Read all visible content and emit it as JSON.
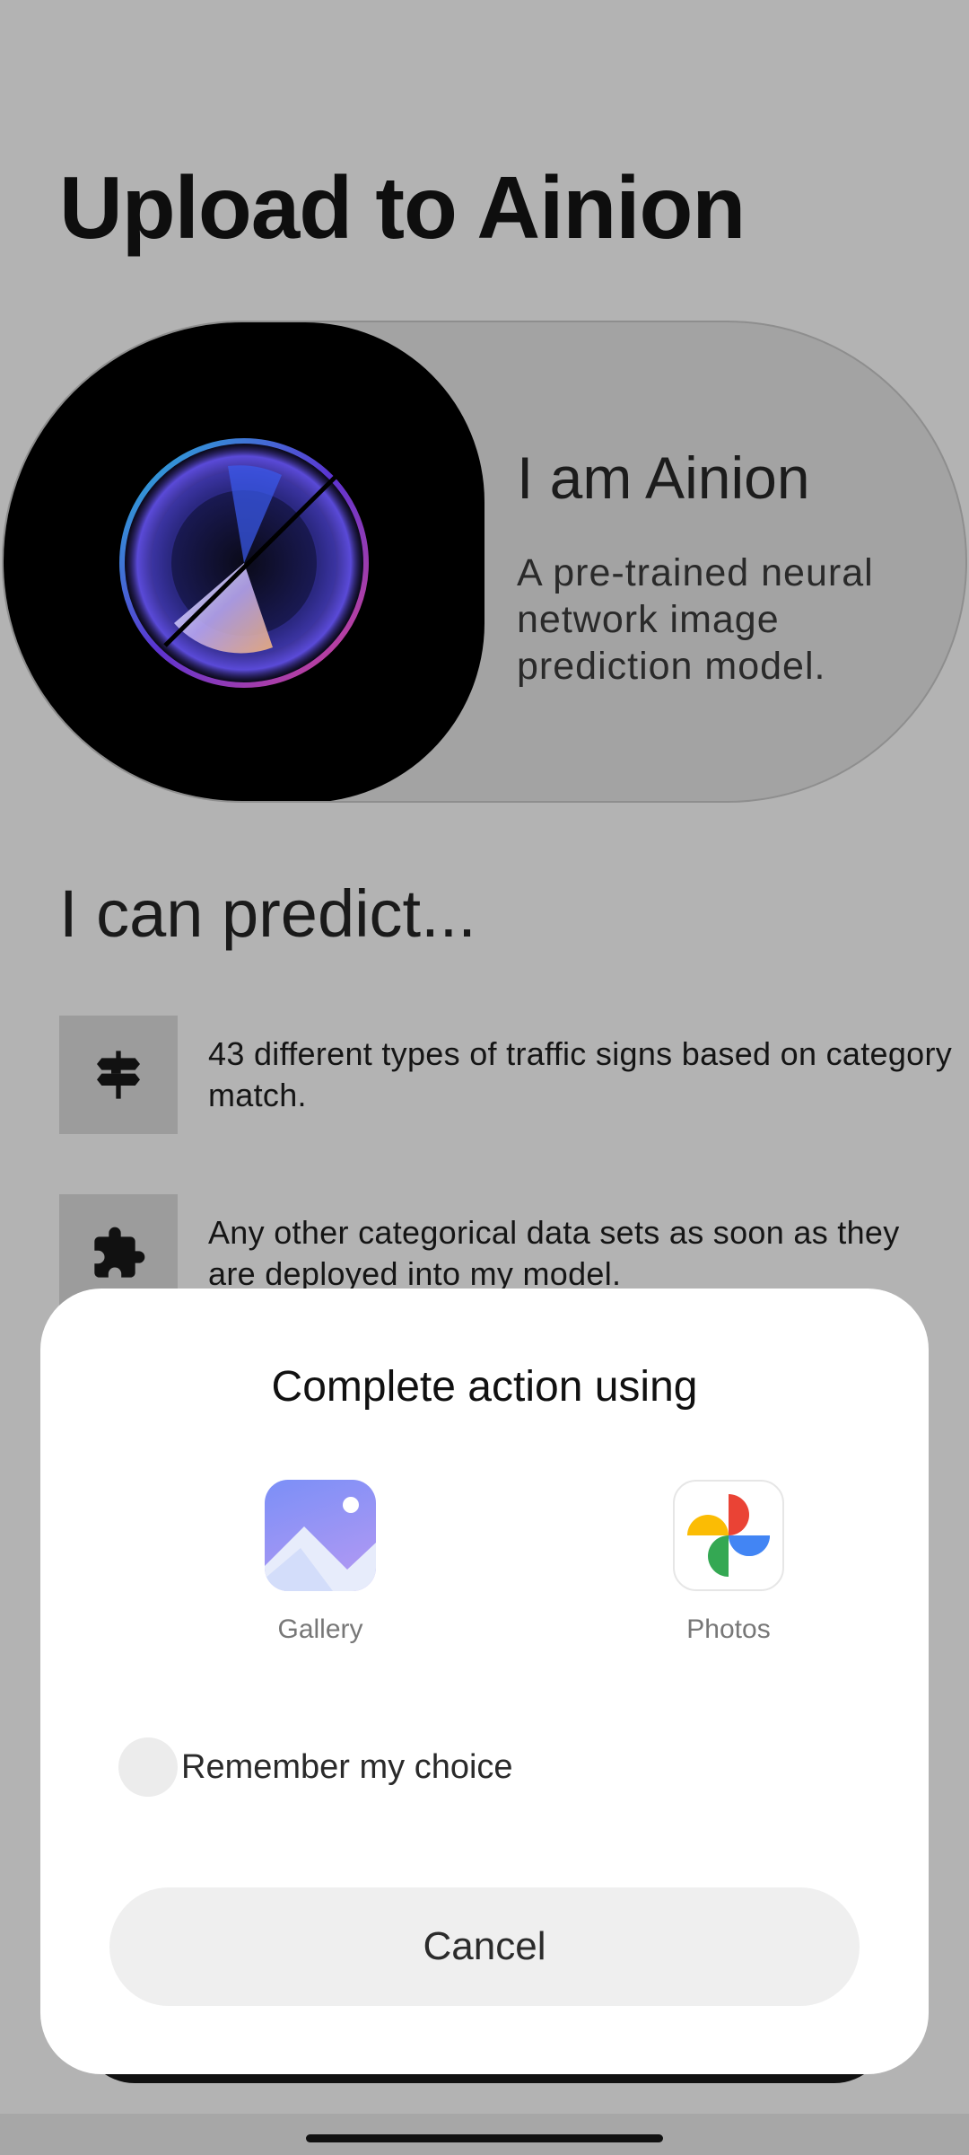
{
  "app": {
    "title": "Upload to Ainion"
  },
  "hero": {
    "image_icon": "ainion-orb-logo",
    "heading": "I am Ainion",
    "description": "A pre-trained neural network image prediction model."
  },
  "features": {
    "heading": "I can predict...",
    "items": [
      {
        "icon": "signpost-icon",
        "text": "43 different types of traffic signs based on category match."
      },
      {
        "icon": "puzzle-icon",
        "text": "Any other categorical data sets as soon as they are deployed into my model."
      }
    ]
  },
  "chooser": {
    "title": "Complete action using",
    "apps": [
      {
        "icon": "gallery-icon",
        "label": "Gallery"
      },
      {
        "icon": "photos-icon",
        "label": "Photos"
      }
    ],
    "remember_label": "Remember my choice",
    "remember_checked": false,
    "cancel_label": "Cancel"
  },
  "colors": {
    "scrim_background": "#b3b3b3",
    "sheet_background": "#ffffff",
    "button_background": "#efefef",
    "gallery_gradient_start": "#7b8ff7",
    "gallery_gradient_end": "#b89af2",
    "photos_red": "#ea4335",
    "photos_blue": "#4285f4",
    "photos_green": "#34a853",
    "photos_yellow": "#fbbc04"
  }
}
